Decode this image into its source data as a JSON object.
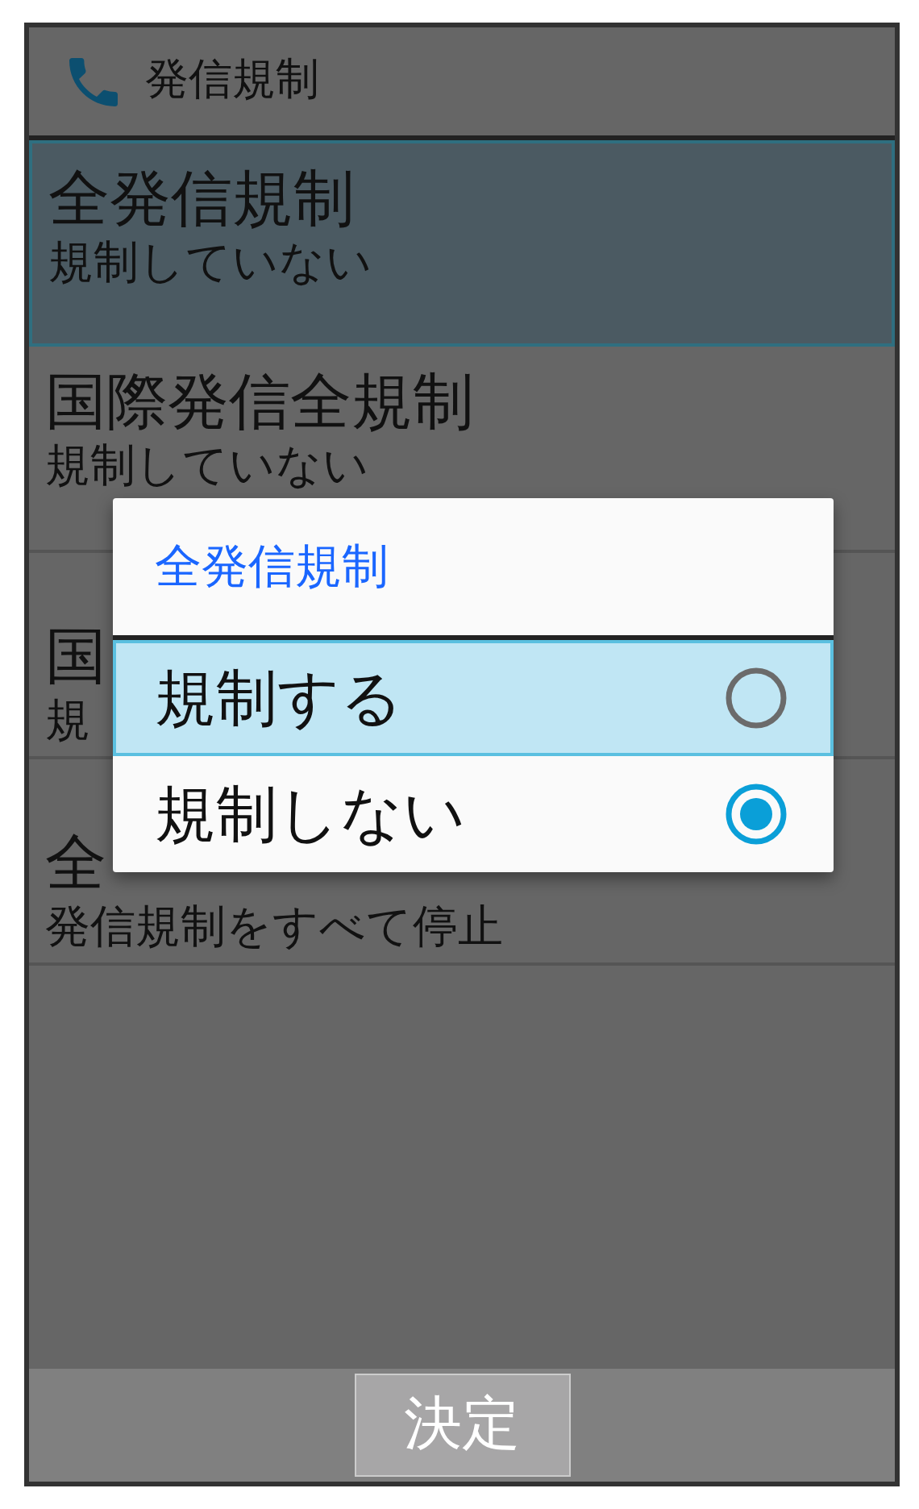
{
  "header": {
    "title": "発信規制"
  },
  "items": [
    {
      "title": "全発信規制",
      "subtitle": "規制していない",
      "focused": true
    },
    {
      "title": "国際発信全規制",
      "subtitle": "規制していない",
      "focused": false
    },
    {
      "title": "国",
      "subtitle": "規",
      "focused": false
    },
    {
      "title": "全",
      "subtitle": "発信規制をすべて停止",
      "focused": false
    }
  ],
  "dialog": {
    "title": "全発信規制",
    "options": [
      {
        "label": "規制する",
        "selected": false,
        "focused": true
      },
      {
        "label": "規制しない",
        "selected": true,
        "focused": false
      }
    ]
  },
  "softkey": {
    "center": "決定"
  }
}
